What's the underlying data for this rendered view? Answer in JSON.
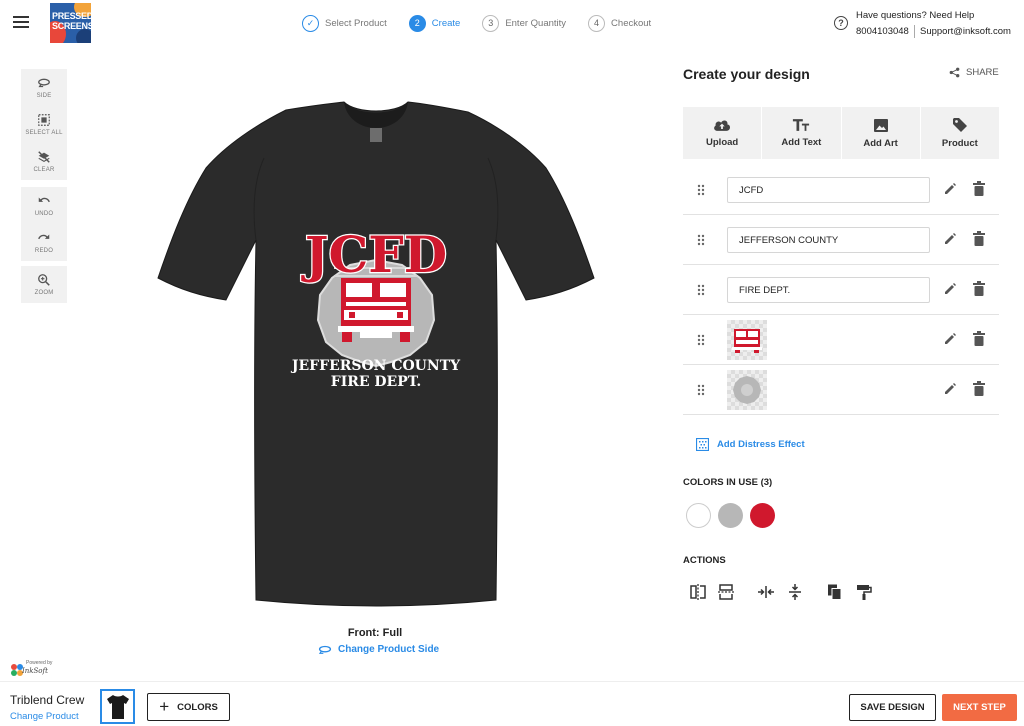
{
  "header": {
    "logo_text": "PRESSED SCREENS",
    "steps": [
      {
        "number": "✓",
        "label": "Select Product",
        "state": "done"
      },
      {
        "number": "2",
        "label": "Create",
        "state": "active"
      },
      {
        "number": "3",
        "label": "Enter Quantity",
        "state": "pending"
      },
      {
        "number": "4",
        "label": "Checkout",
        "state": "pending"
      }
    ],
    "help": {
      "question": "Have questions? Need Help",
      "phone": "8004103048",
      "email": "Support@inksoft.com"
    }
  },
  "tools": {
    "side": "SIDE",
    "select_all": "SELECT ALL",
    "clear": "CLEAR",
    "undo": "UNDO",
    "redo": "REDO",
    "zoom": "ZOOM"
  },
  "canvas": {
    "design_title": "JCFD",
    "design_line1": "JEFFERSON COUNTY",
    "design_line2": "FIRE DEPT.",
    "front_label": "Front: Full",
    "change_side": "Change Product Side",
    "powered_by": "Powered by",
    "powered_brand": "InkSoft"
  },
  "panel": {
    "title": "Create your design",
    "share": "SHARE",
    "add_buttons": {
      "upload": "Upload",
      "add_text": "Add Text",
      "add_art": "Add Art",
      "product": "Product"
    },
    "layers": [
      {
        "type": "text",
        "value": "JCFD"
      },
      {
        "type": "text",
        "value": "JEFFERSON COUNTY"
      },
      {
        "type": "text",
        "value": "FIRE DEPT."
      },
      {
        "type": "image",
        "icon": "fire-truck-art-icon"
      },
      {
        "type": "image",
        "icon": "badge-shield-art-icon"
      }
    ],
    "distress": "Add Distress Effect",
    "colors_title": "COLORS IN USE (3)",
    "colors": [
      "#ffffff",
      "#b7b7b7",
      "#d0182d"
    ],
    "actions_title": "ACTIONS"
  },
  "footer": {
    "product_name": "Triblend Crew",
    "change_product": "Change Product",
    "colors_button": "COLORS",
    "save_button": "SAVE DESIGN",
    "next_button": "NEXT STEP"
  },
  "theme": {
    "accent": "#2a8be6",
    "shirt": "#2b2b2b",
    "design_red": "#d0182d",
    "next_button": "#f26b43"
  }
}
